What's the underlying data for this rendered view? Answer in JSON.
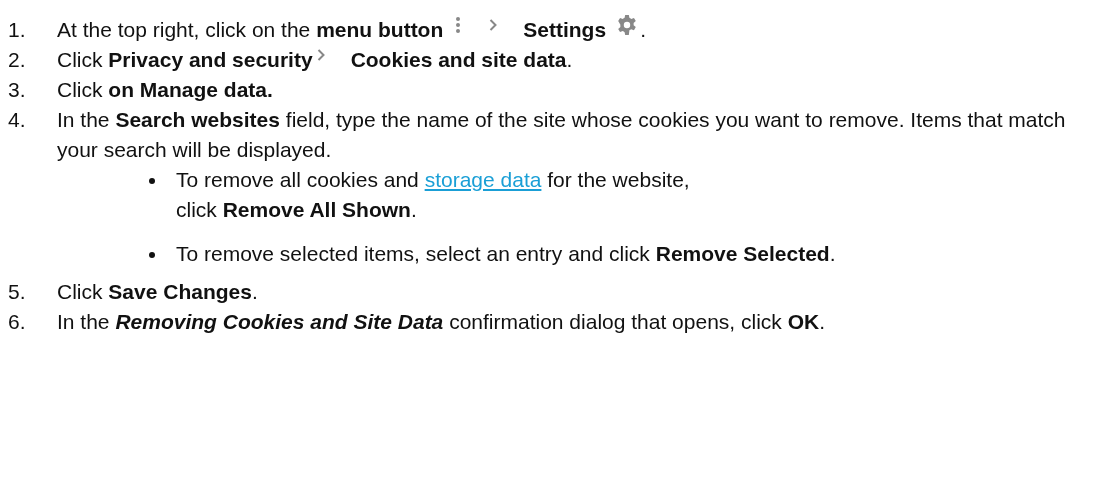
{
  "steps": [
    {
      "number": "1.",
      "segments": [
        {
          "kind": "text",
          "text": "At the top right, click on the **menu button**"
        },
        {
          "kind": "kebab"
        },
        {
          "kind": "chevron"
        },
        {
          "kind": "text",
          "text": "**Settings**"
        },
        {
          "kind": "gear"
        },
        {
          "kind": "text",
          "text": "."
        }
      ]
    },
    {
      "number": "2.",
      "segments": [
        {
          "kind": "text",
          "text": "Click **Privacy and security**"
        },
        {
          "kind": "chevron"
        },
        {
          "kind": "text",
          "text": "**Cookies and site data**."
        }
      ]
    },
    {
      "number": "3.",
      "segments": [
        {
          "kind": "text",
          "text": "Click **on Manage data.**"
        }
      ]
    },
    {
      "number": "4.",
      "segments": [
        {
          "kind": "text",
          "text": "In the **Search websites** field, type the name of the site whose cookies you want to remove. Items that match your search will be displayed."
        }
      ],
      "bullets": [
        {
          "segments": [
            {
              "kind": "text",
              "text": "To remove all cookies and "
            },
            {
              "kind": "link",
              "text": "storage data"
            },
            {
              "kind": "text",
              "text": " for the website,"
            },
            {
              "kind": "break"
            },
            {
              "kind": "text",
              "text": "click **Remove All Shown**."
            }
          ]
        },
        {
          "segments": [
            {
              "kind": "text",
              "text": "To remove selected items, select an entry and click **Remove Selected**."
            }
          ]
        }
      ]
    },
    {
      "number": "5.",
      "segments": [
        {
          "kind": "text",
          "text": "Click **Save Changes**."
        }
      ]
    },
    {
      "number": "6.",
      "segments": [
        {
          "kind": "text",
          "text": "In the "
        },
        {
          "kind": "emphasis",
          "text": "Removing Cookies and Site Data"
        },
        {
          "kind": "text",
          "text": " confirmation dialog that opens, click **OK**."
        }
      ]
    }
  ]
}
